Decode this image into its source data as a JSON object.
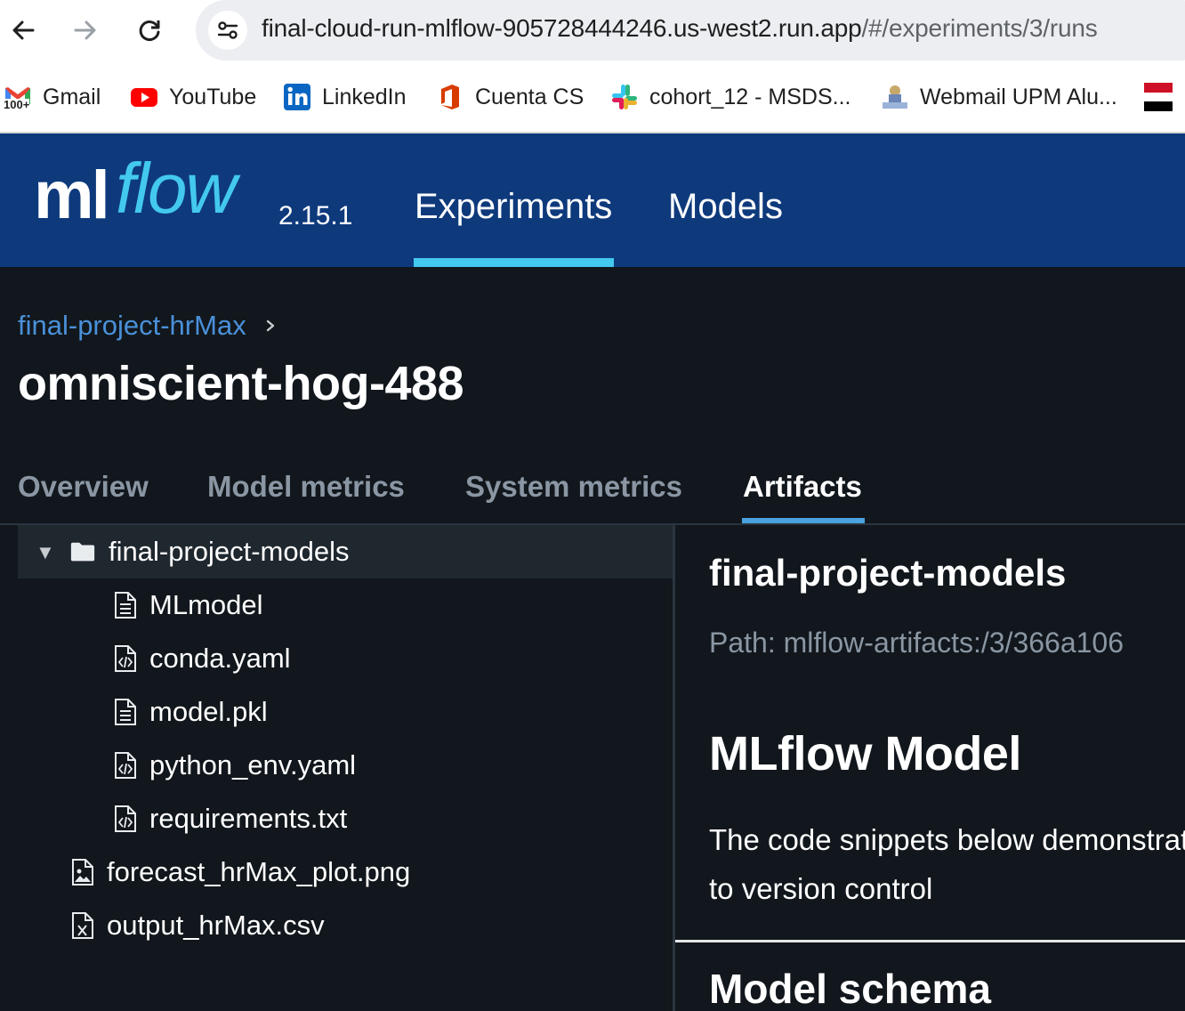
{
  "browser": {
    "url_host": "final-cloud-run-mlflow-905728444246.us-west2.run.app",
    "url_path": "/#/experiments/3/runs",
    "gmail_badge": "100+",
    "bookmarks": [
      {
        "label": "Gmail",
        "icon": "gmail-icon"
      },
      {
        "label": "YouTube",
        "icon": "youtube-icon"
      },
      {
        "label": "LinkedIn",
        "icon": "linkedin-icon"
      },
      {
        "label": "Cuenta CS",
        "icon": "office-icon"
      },
      {
        "label": "cohort_12 - MSDS...",
        "icon": "slack-icon"
      },
      {
        "label": "Webmail UPM Alu...",
        "icon": "webmail-icon"
      }
    ]
  },
  "header": {
    "logo_ml": "ml",
    "logo_flow": "flow",
    "version": "2.15.1",
    "nav": [
      "Experiments",
      "Models"
    ],
    "active_nav": "Experiments"
  },
  "run": {
    "breadcrumb": "final-project-hrMax",
    "title": "omniscient-hog-488",
    "tabs": [
      "Overview",
      "Model metrics",
      "System metrics",
      "Artifacts"
    ],
    "active_tab": "Artifacts"
  },
  "artifacts": {
    "folder": "final-project-models",
    "children": [
      "MLmodel",
      "conda.yaml",
      "model.pkl",
      "python_env.yaml",
      "requirements.txt"
    ],
    "files": [
      "forecast_hrMax_plot.png",
      "output_hrMax.csv"
    ]
  },
  "panel": {
    "title": "final-project-models",
    "path": "Path: mlflow-artifacts:/3/366a106",
    "heading": "MLflow Model",
    "body_line1": "The code snippets below demonstrate",
    "body_line2": "to version control",
    "schema_heading": "Model schema"
  },
  "colors": {
    "header_bg": "#0e3a7c",
    "accent": "#43c9ed",
    "page_bg": "#11171c",
    "link": "#4a90d9"
  }
}
